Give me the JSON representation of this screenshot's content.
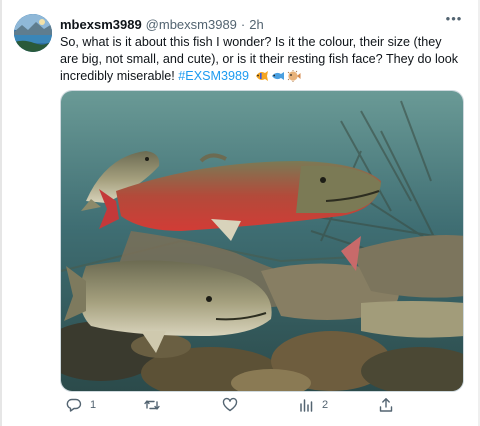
{
  "tweet": {
    "display_name": "mbexsm3989",
    "handle": "@mbexsm3989",
    "separator": "·",
    "time": "2h",
    "more_label": "•••",
    "text": "So, what is it about this fish I wonder? Is it the colour, their size (they are big, not small, and cute), or is it their resting fish face? They do look incredibly miserable! ",
    "hashtag": "#EXSM3989",
    "emojis": [
      "tropical-fish",
      "fish",
      "blowfish"
    ],
    "media_icon": "bull-trout-photo"
  },
  "actions": {
    "reply_count": "1",
    "retweet_count": "",
    "like_count": "",
    "views_count": "2",
    "share_count": ""
  },
  "colors": {
    "accent": "#1d9bf0",
    "secondary_text": "#536471",
    "text": "#0f1419",
    "water": "#3f6e73",
    "fish_red": "#c4393a"
  }
}
